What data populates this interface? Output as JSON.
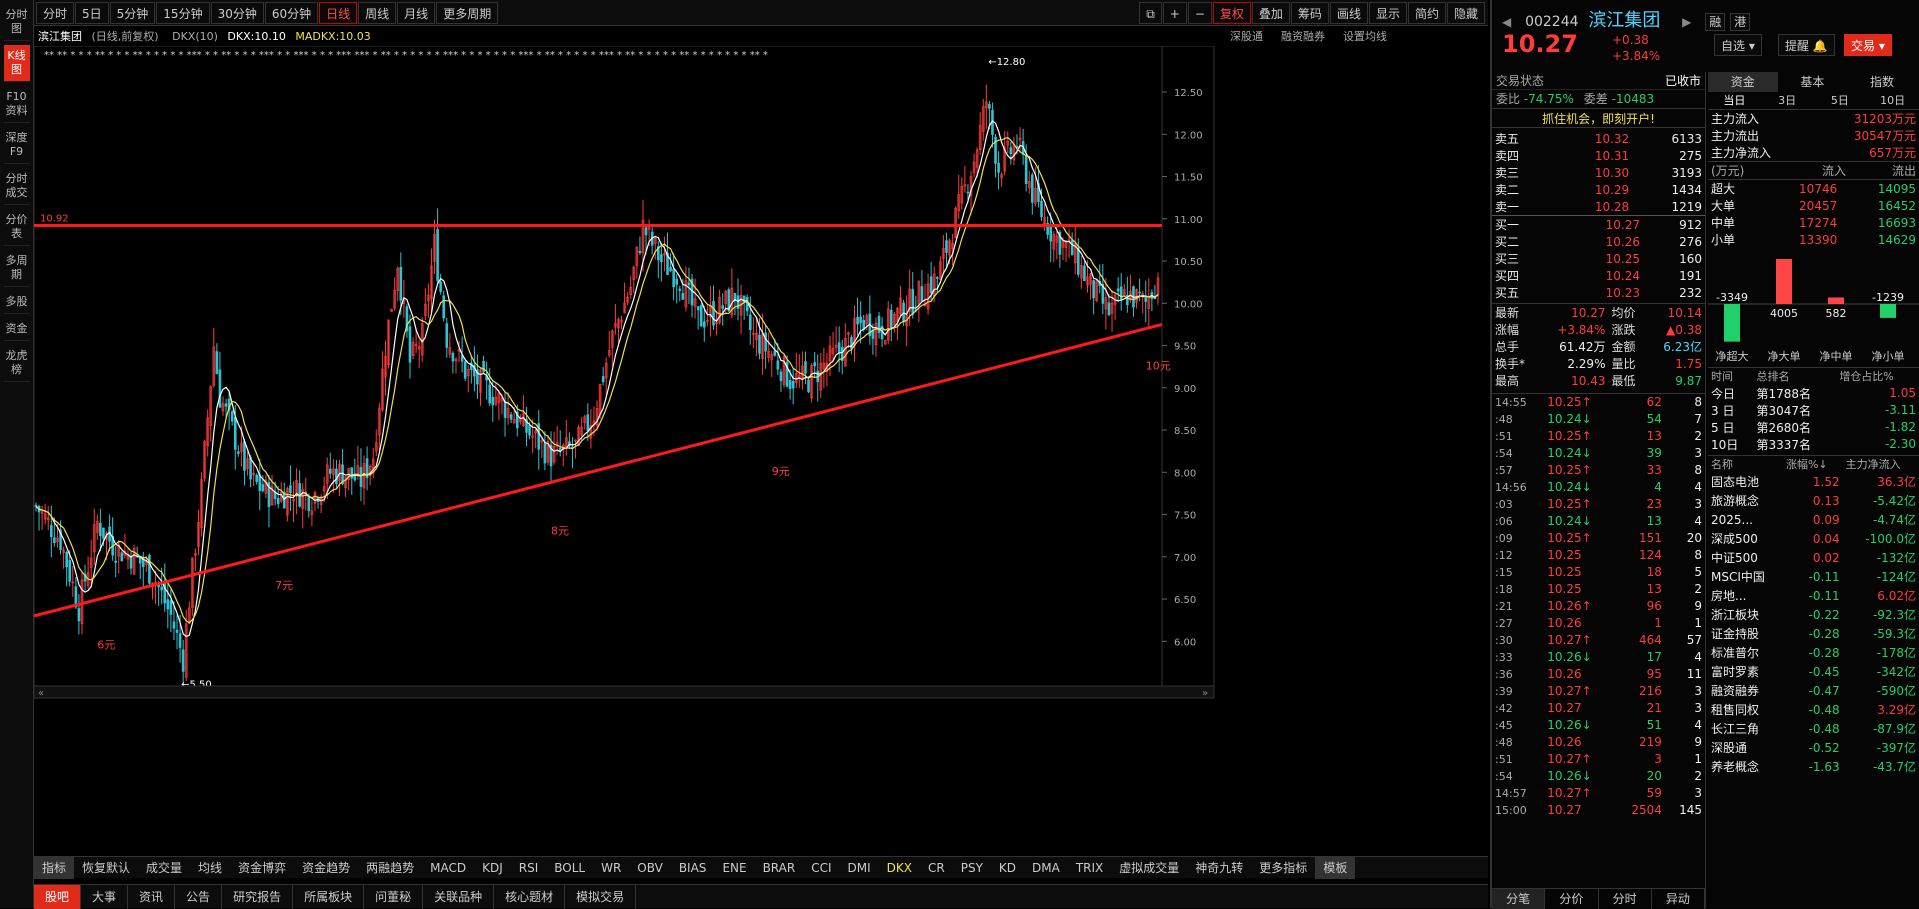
{
  "left_nav": [
    "分时图",
    "K线图",
    "F10资料",
    "深度F9",
    "分时成交",
    "分价表",
    "多周期",
    "多股",
    "资金",
    "龙虎榜"
  ],
  "left_nav_active": 1,
  "periods": [
    "分时",
    "5日",
    "5分钟",
    "15分钟",
    "30分钟",
    "60分钟",
    "日线",
    "周线",
    "月线",
    "更多周期"
  ],
  "period_active": 6,
  "toolbar_right": [
    "复权",
    "叠加",
    "筹码",
    "画线",
    "显示",
    "简约",
    "隐藏"
  ],
  "chart_title": {
    "name": "滨江集团",
    "desc": "(日线,前复权)",
    "ind1": "DKX(10)",
    "dkx": "DKX:10.10",
    "madkx": "MADKX:10.03"
  },
  "chart_links": [
    "深股通",
    "融资融券",
    "设置均线"
  ],
  "chart_data": {
    "type": "candlestick",
    "y_ticks": [
      "12.50",
      "12.00",
      "11.50",
      "11.00",
      "10.50",
      "10.00",
      "9.50",
      "9.00",
      "8.50",
      "8.00",
      "7.50",
      "7.00",
      "6.50",
      "6.00"
    ],
    "ylim": [
      5.4,
      12.95
    ],
    "close_path": [
      [
        0,
        7.6
      ],
      [
        8,
        7.2
      ],
      [
        14,
        6.4
      ],
      [
        20,
        7.4
      ],
      [
        26,
        7.1
      ],
      [
        32,
        7.0
      ],
      [
        38,
        6.8
      ],
      [
        44,
        6.3
      ],
      [
        48,
        5.8
      ],
      [
        50,
        6.5
      ],
      [
        54,
        7.8
      ],
      [
        58,
        9.5
      ],
      [
        60,
        8.9
      ],
      [
        64,
        8.5
      ],
      [
        70,
        7.9
      ],
      [
        78,
        7.7
      ],
      [
        84,
        7.8
      ],
      [
        90,
        7.7
      ],
      [
        96,
        8.0
      ],
      [
        100,
        8.0
      ],
      [
        106,
        7.9
      ],
      [
        110,
        8.2
      ],
      [
        114,
        9.5
      ],
      [
        118,
        10.5
      ],
      [
        122,
        9.3
      ],
      [
        126,
        9.6
      ],
      [
        130,
        10.7
      ],
      [
        134,
        9.6
      ],
      [
        140,
        9.2
      ],
      [
        150,
        8.9
      ],
      [
        160,
        8.5
      ],
      [
        168,
        8.2
      ],
      [
        176,
        8.3
      ],
      [
        182,
        8.7
      ],
      [
        188,
        9.6
      ],
      [
        194,
        10.2
      ],
      [
        198,
        10.9
      ],
      [
        204,
        10.5
      ],
      [
        210,
        10.3
      ],
      [
        216,
        9.8
      ],
      [
        222,
        9.9
      ],
      [
        228,
        10.1
      ],
      [
        234,
        9.6
      ],
      [
        240,
        9.4
      ],
      [
        246,
        9.1
      ],
      [
        252,
        9.1
      ],
      [
        258,
        9.3
      ],
      [
        264,
        9.5
      ],
      [
        270,
        9.8
      ],
      [
        276,
        9.7
      ],
      [
        282,
        9.9
      ],
      [
        288,
        10.1
      ],
      [
        294,
        10.3
      ],
      [
        300,
        11.0
      ],
      [
        306,
        11.7
      ],
      [
        310,
        12.4
      ],
      [
        314,
        11.6
      ],
      [
        320,
        11.9
      ],
      [
        326,
        11.2
      ],
      [
        332,
        10.8
      ],
      [
        338,
        10.6
      ],
      [
        344,
        10.2
      ],
      [
        350,
        9.9
      ],
      [
        356,
        10.1
      ],
      [
        362,
        10.0
      ],
      [
        366,
        10.3
      ]
    ],
    "resistance": "10.92",
    "high_marker": "12.80",
    "low_marker": "5.50",
    "annotations": [
      "6元",
      "7元",
      "8元",
      "9元",
      "10元"
    ],
    "lines": [
      {
        "name": "resistance",
        "color": "#ff1a1a"
      },
      {
        "name": "support",
        "color": "#ff1a1a"
      }
    ],
    "ma_colors": [
      "#ffffff",
      "#f0e050"
    ]
  },
  "indicators": [
    "指标",
    "恢复默认",
    "成交量",
    "均线",
    "资金博弈",
    "资金趋势",
    "两融趋势",
    "MACD",
    "KDJ",
    "RSI",
    "BOLL",
    "WR",
    "OBV",
    "BIAS",
    "ENE",
    "BRAR",
    "CCI",
    "DMI",
    "DKX",
    "CR",
    "PSY",
    "KD",
    "DMA",
    "TRIX",
    "虚拟成交量",
    "神奇九转",
    "更多指标",
    "模板"
  ],
  "bottom_tabs": [
    "股吧",
    "大事",
    "资讯",
    "公告",
    "研究报告",
    "所属板块",
    "问董秘",
    "关联品种",
    "核心题材",
    "模拟交易"
  ],
  "quote": {
    "code": "002244",
    "name": "滨江集团",
    "price": "10.27",
    "chg": "+0.38",
    "pct": "+3.84%",
    "btns": [
      "融",
      "港"
    ],
    "actions": [
      "自选",
      "提醒",
      "交易"
    ]
  },
  "status": {
    "label": "交易状态",
    "value": "已收市",
    "weibi": "委比",
    "weibi_v": "-74.75%",
    "weicha": "委差",
    "weicha_v": "-10483",
    "banner": "抓住机会，即刻开户!"
  },
  "asks": [
    [
      "卖五",
      "10.32",
      "6133"
    ],
    [
      "卖四",
      "10.31",
      "275"
    ],
    [
      "卖三",
      "10.30",
      "3193"
    ],
    [
      "卖二",
      "10.29",
      "1434"
    ],
    [
      "卖一",
      "10.28",
      "1219"
    ]
  ],
  "bids": [
    [
      "买一",
      "10.27",
      "912"
    ],
    [
      "买二",
      "10.26",
      "276"
    ],
    [
      "买三",
      "10.25",
      "160"
    ],
    [
      "买四",
      "10.24",
      "191"
    ],
    [
      "买五",
      "10.23",
      "232"
    ]
  ],
  "stats": [
    [
      "最新",
      "10.27",
      "均价",
      "10.14"
    ],
    [
      "涨幅",
      "+3.84%",
      "涨跌",
      "▲0.38"
    ],
    [
      "总手",
      "61.42万",
      "金额",
      "6.23亿"
    ],
    [
      "换手*",
      "2.29%",
      "量比",
      "1.75"
    ],
    [
      "最高",
      "10.43",
      "最低",
      "9.87"
    ]
  ],
  "ticks": [
    [
      "14:55",
      "10.25↑",
      "62",
      "8"
    ],
    [
      ":48",
      "10.24↓",
      "54",
      "7"
    ],
    [
      ":51",
      "10.25↑",
      "13",
      "2"
    ],
    [
      ":54",
      "10.24↓",
      "39",
      "3"
    ],
    [
      ":57",
      "10.25↑",
      "33",
      "8"
    ],
    [
      "14:56",
      "10.24↓",
      "4",
      "4"
    ],
    [
      ":03",
      "10.25↑",
      "23",
      "3"
    ],
    [
      ":06",
      "10.24↓",
      "13",
      "4"
    ],
    [
      ":09",
      "10.25↑",
      "151",
      "20"
    ],
    [
      ":12",
      "10.25",
      "124",
      "8"
    ],
    [
      ":15",
      "10.25",
      "18",
      "5"
    ],
    [
      ":18",
      "10.25",
      "13",
      "2"
    ],
    [
      ":21",
      "10.26↑",
      "96",
      "9"
    ],
    [
      ":27",
      "10.26",
      "1",
      "1"
    ],
    [
      ":30",
      "10.27↑",
      "464",
      "57"
    ],
    [
      ":33",
      "10.26↓",
      "17",
      "4"
    ],
    [
      ":36",
      "10.26",
      "95",
      "11"
    ],
    [
      ":39",
      "10.27↑",
      "216",
      "3"
    ],
    [
      ":42",
      "10.27",
      "21",
      "3"
    ],
    [
      ":45",
      "10.26↓",
      "51",
      "4"
    ],
    [
      ":48",
      "10.26",
      "219",
      "9"
    ],
    [
      ":51",
      "10.27↑",
      "3",
      "1"
    ],
    [
      ":54",
      "10.26↓",
      "20",
      "2"
    ],
    [
      "14:57",
      "10.27↑",
      "59",
      "3"
    ],
    [
      "15:00",
      "10.27",
      "2504",
      "145"
    ]
  ],
  "tick_tabs": [
    "分笔",
    "分价",
    "分时",
    "异动"
  ],
  "fund": {
    "tabs": [
      "资金",
      "基本",
      "指数"
    ],
    "subtabs": [
      "当日",
      "3日",
      "5日",
      "10日"
    ],
    "main": [
      [
        "主力流入",
        "31203万元"
      ],
      [
        "主力流出",
        "30547万元"
      ],
      [
        "主力净流入",
        "657万元"
      ]
    ],
    "unit": "(万元)",
    "col_in": "流入",
    "col_out": "流出",
    "rows": [
      [
        "超大",
        "10746",
        "14095"
      ],
      [
        "大单",
        "20457",
        "16452"
      ],
      [
        "中单",
        "17274",
        "16693"
      ],
      [
        "小单",
        "13390",
        "14629"
      ]
    ],
    "bars": [
      {
        "label": "净超大",
        "value": -3349
      },
      {
        "label": "净大单",
        "value": 4005
      },
      {
        "label": "净中单",
        "value": 582
      },
      {
        "label": "净小单",
        "value": -1239
      }
    ],
    "rank_head": [
      "时间",
      "总排名",
      "增仓占比%"
    ],
    "ranks": [
      [
        "今日",
        "第1788名",
        "1.05"
      ],
      [
        "3 日",
        "第3047名",
        "-3.11"
      ],
      [
        "5 日",
        "第2680名",
        "-1.82"
      ],
      [
        "10日",
        "第3337名",
        "-2.30"
      ]
    ],
    "sector_head": [
      "名称",
      "涨幅%↓",
      "主力净流入"
    ],
    "sectors": [
      [
        "固态电池",
        "1.52",
        "36.3亿"
      ],
      [
        "旅游概念",
        "0.13",
        "-5.42亿"
      ],
      [
        "2025...",
        "0.09",
        "-4.74亿"
      ],
      [
        "深成500",
        "0.04",
        "-100.0亿"
      ],
      [
        "中证500",
        "0.02",
        "-132亿"
      ],
      [
        "MSCI中国",
        "-0.11",
        "-124亿"
      ],
      [
        "房地...",
        "-0.11",
        "6.02亿"
      ],
      [
        "浙江板块",
        "-0.22",
        "-92.3亿"
      ],
      [
        "证金持股",
        "-0.28",
        "-59.3亿"
      ],
      [
        "标准普尔",
        "-0.28",
        "-178亿"
      ],
      [
        "富时罗素",
        "-0.45",
        "-342亿"
      ],
      [
        "融资融券",
        "-0.47",
        "-590亿"
      ],
      [
        "租售同权",
        "-0.48",
        "3.29亿"
      ],
      [
        "长江三角",
        "-0.48",
        "-87.9亿"
      ],
      [
        "深股通",
        "-0.52",
        "-397亿"
      ],
      [
        "养老概念",
        "-1.63",
        "-43.7亿"
      ]
    ]
  }
}
